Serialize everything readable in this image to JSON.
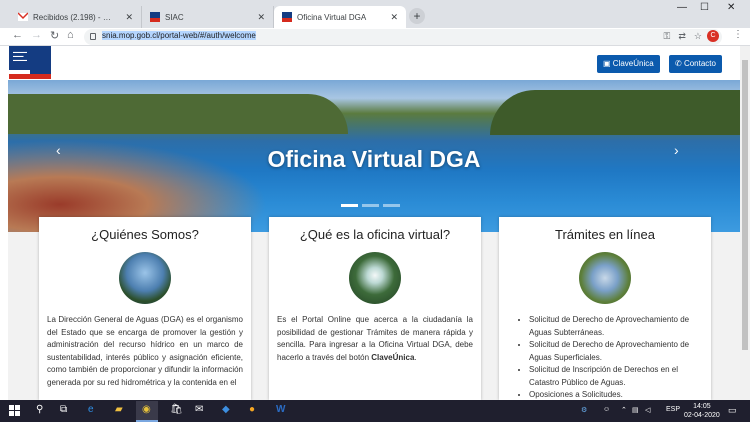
{
  "browser": {
    "tabs": [
      {
        "label": "Recibidos (2.198) - totodechile@",
        "icon": "gmail-icon"
      },
      {
        "label": "SIAC",
        "icon": "siac-icon"
      },
      {
        "label": "Oficina Virtual DGA",
        "icon": "dga-icon"
      }
    ],
    "url": "snia.mop.gob.cl/portal-web/#/auth/welcome",
    "profile_initial": "C"
  },
  "site": {
    "header_buttons": [
      {
        "label": "ClaveÚnica"
      },
      {
        "label": "Contacto"
      }
    ],
    "hero_title": "Oficina Virtual DGA",
    "cards": [
      {
        "title": "¿Quiénes Somos?",
        "text": "La Dirección General de Aguas (DGA) es el organismo del Estado que se encarga de promover la gestión y administración del recurso hídrico en un marco de sustentabilidad, interés público y asignación eficiente, como también de proporcionar y difundir la información generada por su red hidrométrica y la contenida en el"
      },
      {
        "title": "¿Qué es la oficina virtual?",
        "text": "Es el Portal Online que acerca a la ciudadanía la posibilidad de gestionar Trámites de manera rápida y sencilla. Para ingresar a la Oficina Virtual DGA, debe hacerlo a través del botón ",
        "text_bold": "ClaveÚnica",
        "text_end": "."
      },
      {
        "title": "Trámites en línea",
        "items": [
          "Solicitud de Derecho de Aprovechamiento de Aguas Subterráneas.",
          "Solicitud de Derecho de Aprovechamiento de Aguas Superficiales.",
          "Solicitud de Inscripción de Derechos en el Catastro Público de Aguas.",
          "Oposiciones a Solicitudes."
        ]
      }
    ]
  },
  "taskbar": {
    "language": "ESP",
    "time": "14:05",
    "date": "02-04-2020"
  },
  "colors": {
    "brand_blue": "#0b5aad",
    "chile_blue": "#143c82",
    "chile_red": "#d52b1e"
  }
}
